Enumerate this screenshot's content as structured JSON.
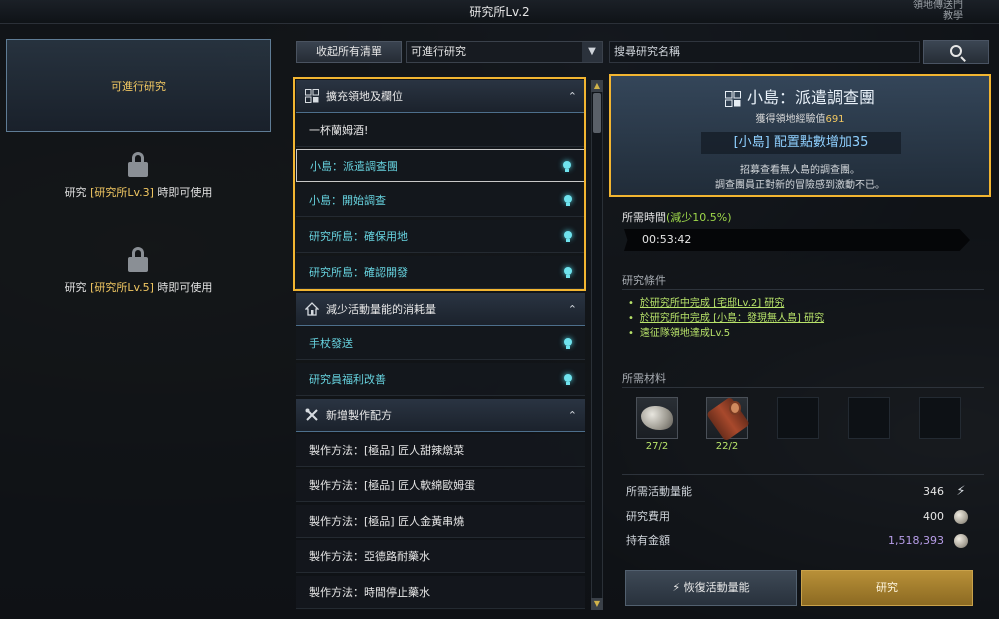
{
  "window": {
    "title": "研究所Lv.2",
    "corner_hint": "領地傳送門 教學"
  },
  "left_panel": {
    "active_tab": "可進行研究",
    "locked": [
      {
        "prefix": "研究 ",
        "highlight": "[研究所Lv.3]",
        "suffix": " 時即可使用"
      },
      {
        "prefix": "研究 ",
        "highlight": "[研究所Lv.5]",
        "suffix": " 時即可使用"
      }
    ]
  },
  "toolbar": {
    "collapse_label": "收起所有清單",
    "filter_value": "可進行研究",
    "search_placeholder": "搜尋研究名稱"
  },
  "list": {
    "groups": [
      {
        "title": "擴充領地及欄位",
        "icon": "grid-icon",
        "items": [
          {
            "label": "一杯蘭姆酒!",
            "available": false
          },
          {
            "label": "小島：派遣調查團",
            "available": true,
            "selected": true
          },
          {
            "label": "小島：開始調查",
            "available": true
          },
          {
            "label": "研究所島：確保用地",
            "available": true
          },
          {
            "label": "研究所島：確認開發",
            "available": true
          }
        ]
      },
      {
        "title": "減少活動量能的消耗量",
        "icon": "house-icon",
        "items": [
          {
            "label": "手杖發送",
            "available": true
          },
          {
            "label": "研究員福利改善",
            "available": true
          }
        ]
      },
      {
        "title": "新增製作配方",
        "icon": "tools-icon",
        "items": [
          {
            "label": "製作方法：[極品] 匠人甜辣燉菜",
            "available": false
          },
          {
            "label": "製作方法：[極品] 匠人軟綿歐姆蛋",
            "available": false
          },
          {
            "label": "製作方法：[極品] 匠人金黃串燒",
            "available": false
          },
          {
            "label": "製作方法：亞德路耐藥水",
            "available": false
          },
          {
            "label": "製作方法：時間停止藥水",
            "available": false
          }
        ]
      }
    ]
  },
  "detail": {
    "title": "小島：派遣調查團",
    "exp_label": "獲得領地經驗值",
    "exp_value": "691",
    "bonus": "[小島] 配置點數增加35",
    "desc_line1": "招募查看無人島的調查團。",
    "desc_line2": "調查團員正對新的冒險感到激動不已。",
    "time_label": "所需時間",
    "time_reduction": "(減少10.5%)",
    "time_value": "00:53:42",
    "conditions_label": "研究條件",
    "conditions": [
      "於研究所中完成 [宅邸Lv.2] 研究",
      "於研究所中完成 [小島：發現無人島] 研究",
      "遠征隊領地達成Lv.5"
    ],
    "materials_label": "所需材料",
    "materials": [
      {
        "icon": "ore-icon",
        "qty": "27/2"
      },
      {
        "icon": "log-icon",
        "qty": "22/2"
      }
    ],
    "stats": {
      "energy_label": "所需活動量能",
      "energy_value": "346",
      "cost_label": "研究費用",
      "cost_value": "400",
      "gold_label": "持有金額",
      "gold_value": "1,518,393"
    },
    "restore_button": "恢復活動量能",
    "research_button": "研究"
  },
  "colors": {
    "highlight_border": "#f2b531",
    "available_text": "#67d3df",
    "condition_text": "#b8e36a",
    "gold_text": "#f2c862"
  }
}
